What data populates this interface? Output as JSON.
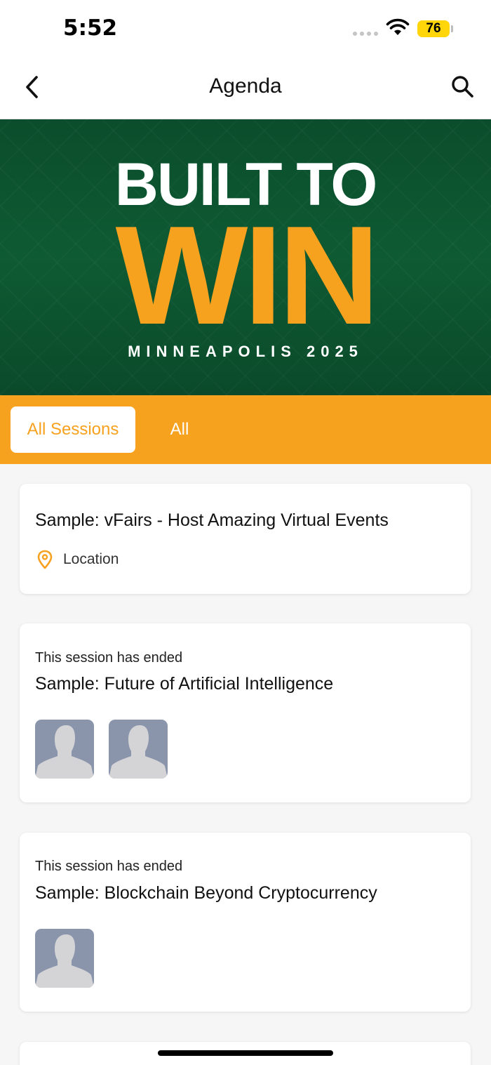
{
  "status_bar": {
    "time": "5:52",
    "battery": "76",
    "battery_color": "#ffd60a"
  },
  "nav": {
    "title": "Agenda",
    "back_icon": "chevron-left-icon",
    "search_icon": "search-icon"
  },
  "banner": {
    "line1": "BUILT TO",
    "line2": "WIN",
    "line3": "MINNEAPOLIS 2025",
    "bg_color": "#0e5a33",
    "accent_color": "#f7a21f"
  },
  "tabs": [
    {
      "label": "All Sessions",
      "active": true
    },
    {
      "label": "All",
      "active": false
    }
  ],
  "sessions": [
    {
      "title": "Sample: vFairs - Host Amazing Virtual Events",
      "location": "Location",
      "speakers": 0
    },
    {
      "status": "This session has ended",
      "title": "Sample: Future of Artificial Intelligence",
      "speakers": 2
    },
    {
      "status": "This session has ended",
      "title": "Sample: Blockchain Beyond Cryptocurrency",
      "speakers": 1
    }
  ]
}
